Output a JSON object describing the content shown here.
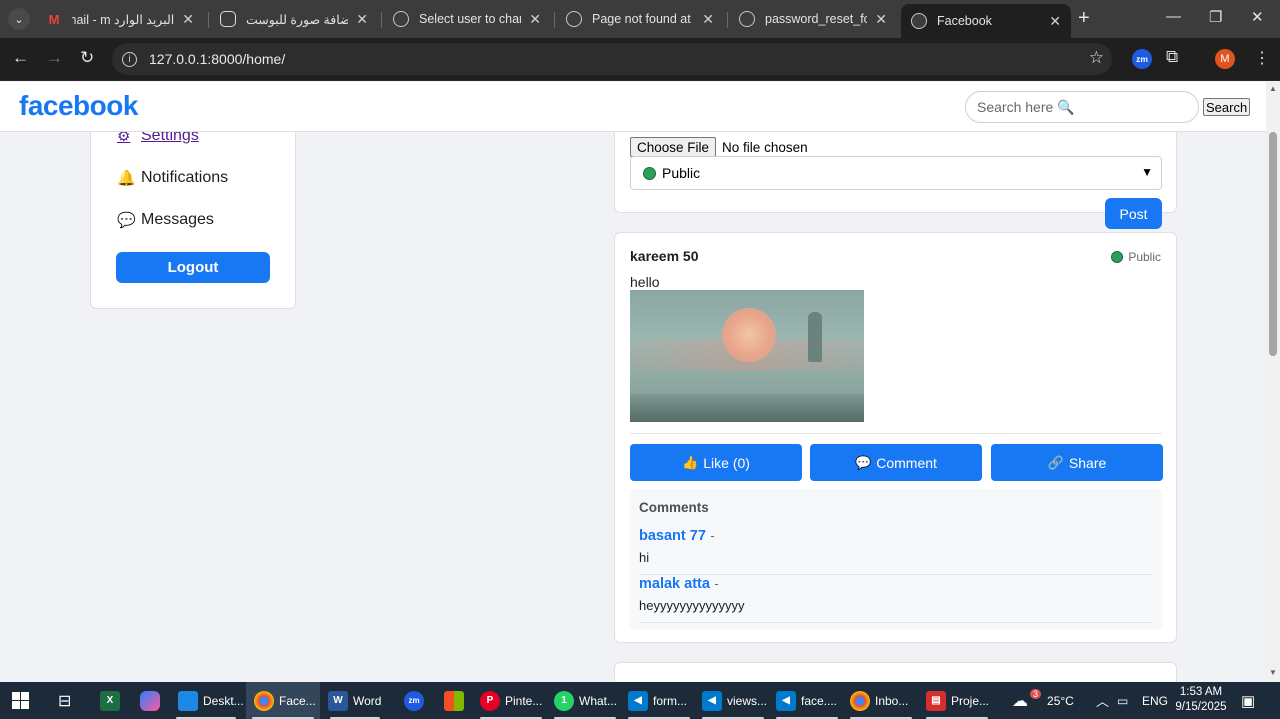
{
  "browser": {
    "tabs": [
      {
        "title": "البريد الوارد Gmail - m",
        "icon": "gmail-icon"
      },
      {
        "title": "إضافة صورة للبوست",
        "icon": "chatgpt-icon"
      },
      {
        "title": "Select user to change",
        "icon": "globe-icon"
      },
      {
        "title": "Page not found at /r",
        "icon": "globe-icon"
      },
      {
        "title": "password_reset_form",
        "icon": "globe-icon"
      },
      {
        "title": "Facebook",
        "icon": "globe-icon"
      }
    ],
    "url": "127.0.0.1:8000/home/",
    "zoom_ext_label": "zm",
    "profile_initial": "M"
  },
  "header": {
    "logo": "facebook",
    "search_placeholder": "Search here 🔍",
    "search_button": "Search"
  },
  "sidebar": {
    "items": [
      {
        "label": "Settings",
        "icon": "gear-icon",
        "glyph": "⚙"
      },
      {
        "label": "Notifications",
        "icon": "bell-icon",
        "glyph": "🔔"
      },
      {
        "label": "Messages",
        "icon": "chat-icon",
        "glyph": "💬"
      }
    ],
    "logout_label": "Logout"
  },
  "composer": {
    "choose_file_label": "Choose File",
    "file_status": "No file chosen",
    "privacy_value": "Public",
    "post_label": "Post"
  },
  "post": {
    "author": "kareem 50",
    "privacy": "Public",
    "text": "hello",
    "actions": {
      "like": "Like (0)",
      "comment": "Comment",
      "share": "Share"
    },
    "comments_title": "Comments",
    "comments": [
      {
        "author": "basant 77",
        "sep": "-",
        "text": "hi"
      },
      {
        "author": "malak atta",
        "sep": "-",
        "text": "heyyyyyyyyyyyyyy"
      }
    ]
  },
  "taskbar": {
    "apps": [
      {
        "label": "Deskt...",
        "color": "#1e88e5"
      },
      {
        "label": "Face...",
        "color": "#e8453c"
      },
      {
        "label": "Word",
        "color": "#2b579a"
      },
      {
        "label": "Pinte...",
        "color": "#e60023"
      },
      {
        "label": "What...",
        "color": "#25d366"
      },
      {
        "label": "form...",
        "color": "#007acc"
      },
      {
        "label": "views...",
        "color": "#007acc"
      },
      {
        "label": "face....",
        "color": "#007acc"
      },
      {
        "label": "Inbo...",
        "color": "#e8453c"
      },
      {
        "label": "Proje...",
        "color": "#d32f2f"
      }
    ],
    "weather": "25°C",
    "weather_badge": "3",
    "whatsapp_badge": "1",
    "language": "ENG",
    "time": "1:53 AM",
    "date": "9/15/2025"
  }
}
